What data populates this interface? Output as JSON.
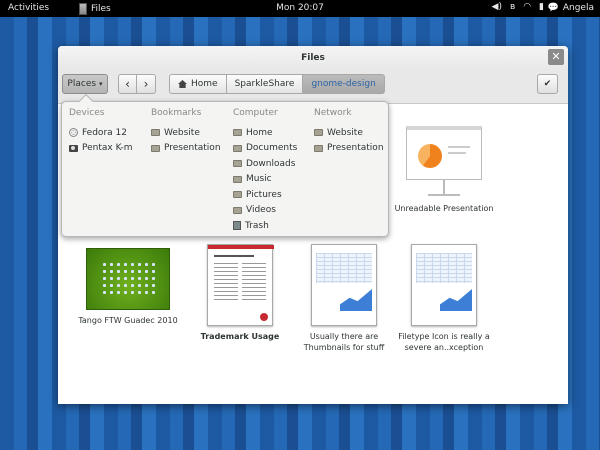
{
  "topbar": {
    "activities": "Activities",
    "app_name": "Files",
    "clock": "Mon 20:07",
    "user": "Angela",
    "tray_icons": [
      "volume-icon",
      "bluetooth-icon",
      "wifi-icon",
      "battery-icon"
    ]
  },
  "window": {
    "title": "Files",
    "close_glyph": "✕"
  },
  "toolbar": {
    "places_label": "Places",
    "back_glyph": "‹",
    "forward_glyph": "›",
    "check_glyph": "✔",
    "path": [
      {
        "label": "Home",
        "icon": "home-icon"
      },
      {
        "label": "SparkleShare"
      },
      {
        "label": "gnome-design",
        "active": true
      }
    ]
  },
  "places": {
    "devices": {
      "heading": "Devices",
      "items": [
        "Fedora 12",
        "Pentax K-m"
      ]
    },
    "bookmarks": {
      "heading": "Bookmarks",
      "items": [
        "Website",
        "Presentation"
      ]
    },
    "computer": {
      "heading": "Computer",
      "items": [
        "Home",
        "Documents",
        "Downloads",
        "Music",
        "Pictures",
        "Videos",
        "Trash"
      ]
    },
    "network": {
      "heading": "Network",
      "items": [
        "Website",
        "Presentation"
      ]
    }
  },
  "files": [
    {
      "label": "Unreadable Presentation",
      "bold": false
    },
    {
      "label": "Tango FTW Guadec 2010",
      "bold": false
    },
    {
      "label": "Trademark Usage",
      "bold": true
    },
    {
      "label": "Usually there are Thumbnails for stuff",
      "bold": false
    },
    {
      "label": "Filetype Icon is really a severe an..xception",
      "bold": false
    }
  ],
  "colors": {
    "accent": "#2b63a4",
    "desktop": "#1d5aa3"
  }
}
